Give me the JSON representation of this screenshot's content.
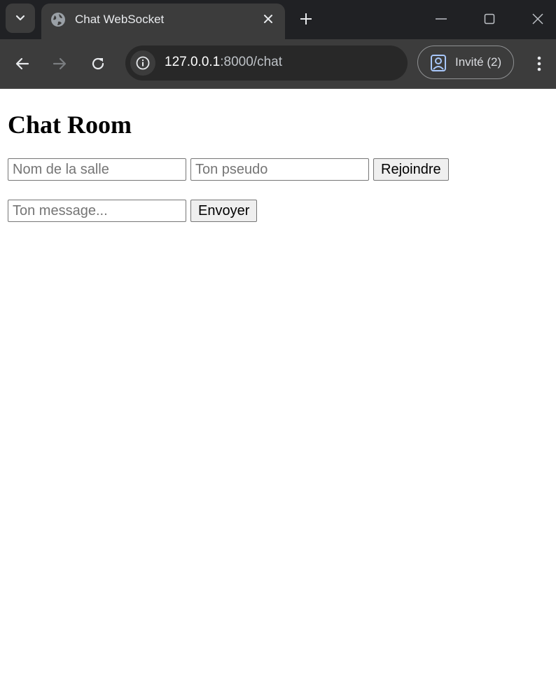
{
  "browser": {
    "tab_title": "Chat WebSocket",
    "url_host": "127.0.0.1",
    "url_path": ":8000/chat",
    "profile_label": "Invité (2)",
    "icons": [
      "tab-search-icon",
      "globe-icon",
      "close-icon",
      "plus-icon",
      "minimize-icon",
      "maximize-icon",
      "window-close-icon",
      "back-icon",
      "forward-icon",
      "reload-icon",
      "info-icon",
      "profile-icon",
      "menu-icon"
    ]
  },
  "page": {
    "title": "Chat Room",
    "room_input_placeholder": "Nom de la salle",
    "pseudo_input_placeholder": "Ton pseudo",
    "join_button": "Rejoindre",
    "message_input_placeholder": "Ton message...",
    "send_button": "Envoyer"
  }
}
